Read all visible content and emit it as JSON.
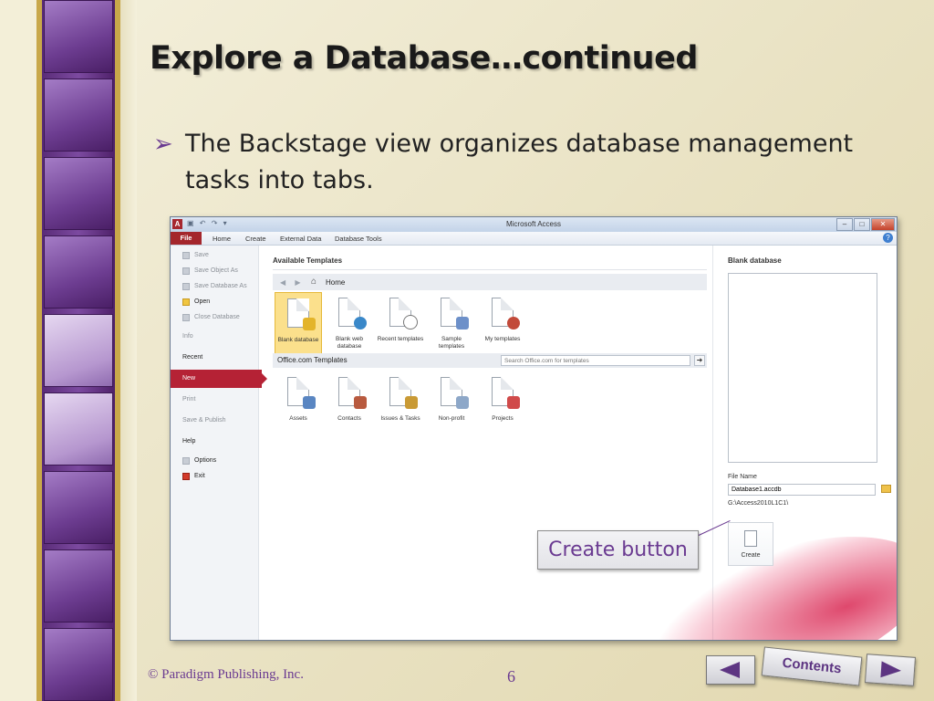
{
  "slide": {
    "title": "Explore a Database…continued",
    "bullet": "The Backstage view organizes database management tasks into tabs.",
    "callout": "Create button",
    "footer": "© Paradigm Publishing, Inc.",
    "page_number": "6",
    "nav": {
      "prev_icon": "left-triangle-icon",
      "contents_label": "Contents",
      "next_icon": "right-triangle-icon"
    }
  },
  "access": {
    "window_title": "Microsoft Access",
    "ribbon_tabs": [
      "File",
      "Home",
      "Create",
      "External Data",
      "Database Tools"
    ],
    "sidebar": {
      "save": "Save",
      "save_object_as": "Save Object As",
      "save_database_as": "Save Database As",
      "open": "Open",
      "close_database": "Close Database",
      "info": "Info",
      "recent": "Recent",
      "new": "New",
      "print": "Print",
      "save_publish": "Save & Publish",
      "help": "Help",
      "options": "Options",
      "exit": "Exit"
    },
    "available_templates": "Available Templates",
    "nav_home": "Home",
    "templates": [
      {
        "label": "Blank database"
      },
      {
        "label": "Blank web database"
      },
      {
        "label": "Recent templates"
      },
      {
        "label": "Sample templates"
      },
      {
        "label": "My templates"
      }
    ],
    "office_templates_label": "Office.com Templates",
    "search_placeholder": "Search Office.com for templates",
    "office_templates": [
      {
        "label": "Assets"
      },
      {
        "label": "Contacts"
      },
      {
        "label": "Issues & Tasks"
      },
      {
        "label": "Non-profit"
      },
      {
        "label": "Projects"
      }
    ],
    "right_pane": {
      "header": "Blank database",
      "file_name_label": "File Name",
      "file_name_value": "Database1.accdb",
      "path": "G:\\Access2010L1C1\\",
      "create_label": "Create"
    }
  },
  "colors": {
    "accent_purple": "#6a3a91",
    "file_tab": "#a4262c",
    "selected_new": "#b52235"
  }
}
